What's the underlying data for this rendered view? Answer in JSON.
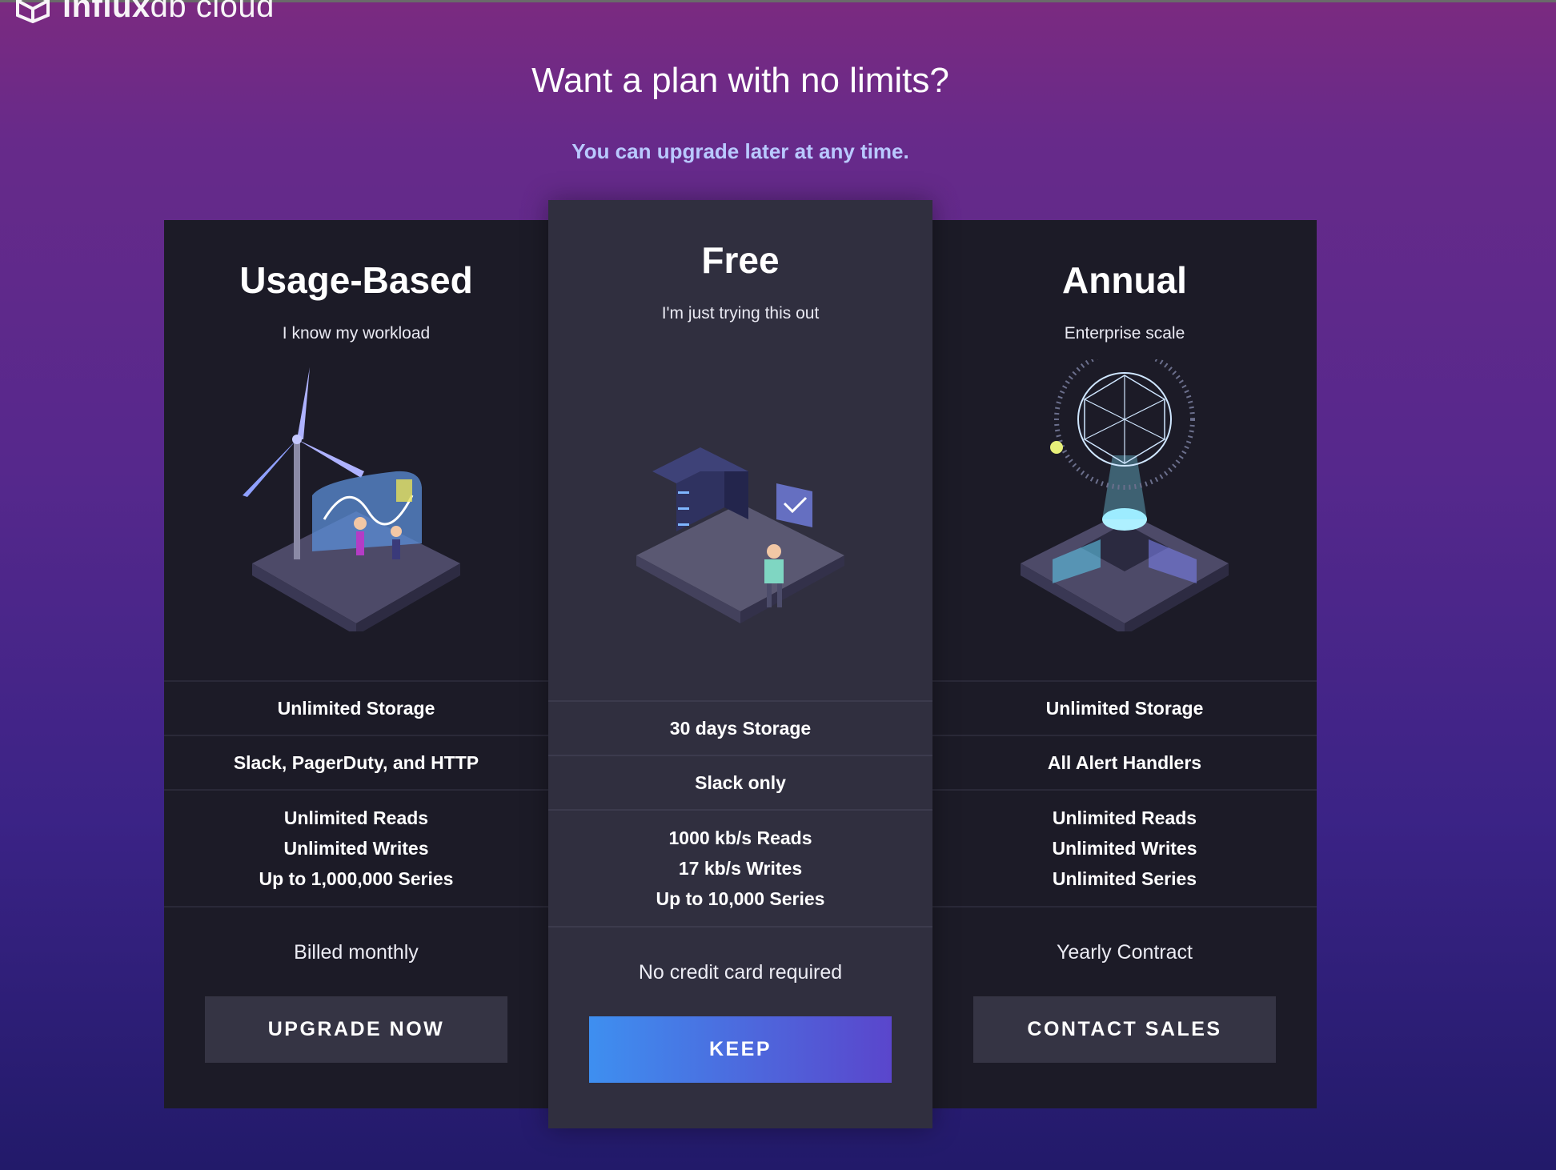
{
  "brand": {
    "logo_bold": "influx",
    "logo_light": "db cloud",
    "icon": "cube-logo-icon"
  },
  "header": {
    "title": "Want a plan with no limits?",
    "subtitle": "You can upgrade later at any time."
  },
  "colors": {
    "subtitle": "#b9c9ff",
    "card_dark": "#1c1b27",
    "card_highlight": "#302f3f",
    "button_dark": "#353444",
    "button_primary_start": "#3e8ff0",
    "button_primary_end": "#5a46cc"
  },
  "plans": {
    "usage": {
      "title": "Usage-Based",
      "tagline": "I know my workload",
      "illustration": "wind-turbine-dashboard-illustration",
      "storage": "Unlimited Storage",
      "alerts": "Slack, PagerDuty, and HTTP",
      "reads": "Unlimited Reads",
      "writes": "Unlimited Writes",
      "series": "Up to 1,000,000 Series",
      "billing": "Billed monthly",
      "button": "UPGRADE NOW"
    },
    "free": {
      "title": "Free",
      "tagline": "I'm just trying this out",
      "illustration": "server-laptop-illustration",
      "storage": "30 days Storage",
      "alerts": "Slack only",
      "reads": "1000 kb/s Reads",
      "writes": "17 kb/s Writes",
      "series": "Up to 10,000 Series",
      "billing": "No credit card required",
      "button": "KEEP"
    },
    "annual": {
      "title": "Annual",
      "tagline": "Enterprise scale",
      "illustration": "geodesic-globe-illustration",
      "storage": "Unlimited Storage",
      "alerts": "All Alert Handlers",
      "reads": "Unlimited Reads",
      "writes": "Unlimited Writes",
      "series": "Unlimited Series",
      "billing": "Yearly Contract",
      "button": "CONTACT SALES"
    }
  }
}
